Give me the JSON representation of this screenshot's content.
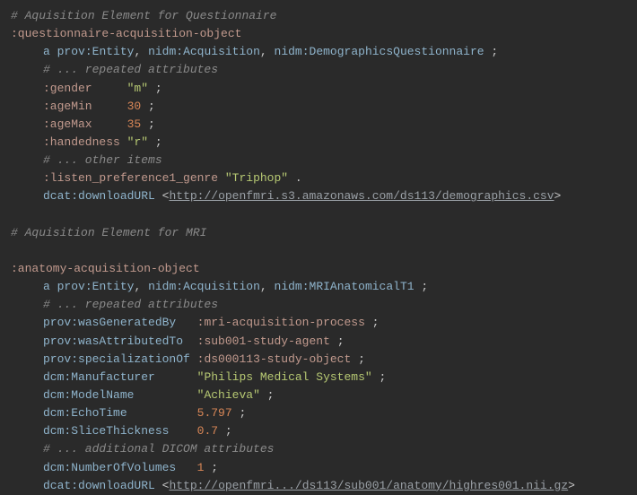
{
  "comments": {
    "c1": "# Aquisition Element for Questionnaire",
    "c2": "# ... repeated attributes",
    "c3": "# ... other items",
    "c4": "# Aquisition Element for MRI",
    "c5": "# ... repeated attributes",
    "c6": "# ... additional DICOM attributes"
  },
  "q": {
    "subject": ":questionnaire-acquisition-object",
    "a": "a",
    "t1p": "prov:",
    "t1n": "Entity",
    "t2p": "nidm:",
    "t2n": "Acquisition",
    "t3p": "nidm:",
    "t3n": "DemographicsQuestionnaire",
    "gender_k": ":gender",
    "gender_v": "\"m\"",
    "ageMin_k": ":ageMin",
    "ageMin_v": "30",
    "ageMax_k": ":ageMax",
    "ageMax_v": "35",
    "hand_k": ":handedness",
    "hand_v": "\"r\"",
    "pref_k": ":listen_preference1_genre",
    "pref_v": "\"Triphop\"",
    "dl_kp": "dcat:",
    "dl_kn": "downloadURL",
    "dl_url": "http://openfmri.s3.amazonaws.com/ds113/demographics.csv"
  },
  "m": {
    "subject": ":anatomy-acquisition-object",
    "a": "a",
    "t1p": "prov:",
    "t1n": "Entity",
    "t2p": "nidm:",
    "t2n": "Acquisition",
    "t3p": "nidm:",
    "t3n": "MRIAnatomicalT1",
    "gen_kp": "prov:",
    "gen_kn": "wasGeneratedBy",
    "gen_v": ":mri-acquisition-process",
    "att_kp": "prov:",
    "att_kn": "wasAttributedTo",
    "att_v": ":sub001-study-agent",
    "spc_kp": "prov:",
    "spc_kn": "specializationOf",
    "spc_v": ":ds000113-study-object",
    "man_kp": "dcm:",
    "man_kn": "Manufacturer",
    "man_v": "\"Philips Medical Systems\"",
    "mod_kp": "dcm:",
    "mod_kn": "ModelName",
    "mod_v": "\"Achieva\"",
    "echo_kp": "dcm:",
    "echo_kn": "EchoTime",
    "echo_v": "5.797",
    "slc_kp": "dcm:",
    "slc_kn": "SliceThickness",
    "slc_v": "0.7",
    "vol_kp": "dcm:",
    "vol_kn": "NumberOfVolumes",
    "vol_v": "1",
    "dl_kp": "dcat:",
    "dl_kn": "downloadURL",
    "dl_url": "http://openfmri.../ds113/sub001/anatomy/highres001.nii.gz"
  },
  "p": {
    "semi": " ;",
    "dot": " .",
    "comma": ", ",
    "lt": "<",
    "gt": ">"
  }
}
